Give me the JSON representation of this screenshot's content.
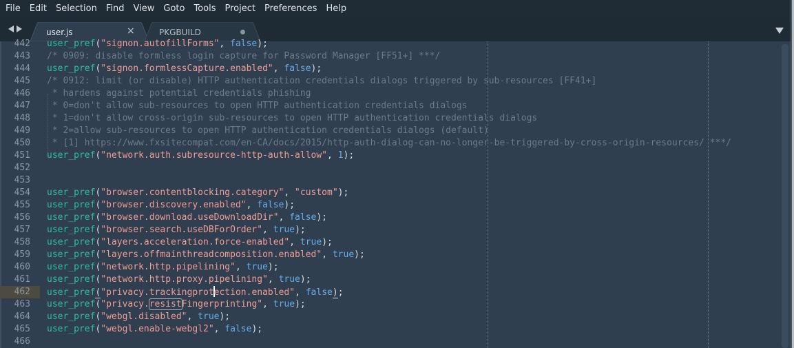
{
  "menubar": {
    "items": [
      "File",
      "Edit",
      "Selection",
      "Find",
      "View",
      "Goto",
      "Tools",
      "Project",
      "Preferences",
      "Help"
    ]
  },
  "tabs": [
    {
      "label": "user.js",
      "active": true,
      "state_icon": "close-icon",
      "close_glyph": "×"
    },
    {
      "label": "PKGBUILD",
      "active": false,
      "state_icon": "unsaved-dot-icon"
    }
  ],
  "navigation": {
    "back_icon": "arrow-left-icon",
    "forward_icon": "arrow-right-icon",
    "tab_menu_icon": "triangle-down-icon"
  },
  "editor": {
    "active_line": 462,
    "find_match": {
      "line": 463,
      "text": "resist"
    },
    "colors": {
      "background": "#2f3f50",
      "function": "#2ebf9f",
      "string": "#f09c94",
      "boolean": "#66aee8",
      "comment": "#6a7b8a",
      "line_number": "#8b97a2",
      "active_gutter": "#4d4a3f"
    },
    "lines": [
      {
        "n": "442",
        "tokens": [
          [
            "fn",
            "user_pref"
          ],
          [
            "p",
            "("
          ],
          [
            "s",
            "\"signon.autofillForms\""
          ],
          [
            "p",
            ", "
          ],
          [
            "b",
            "false"
          ],
          [
            "p",
            ");"
          ]
        ]
      },
      {
        "n": "443",
        "tokens": [
          [
            "c",
            "/* 0909: disable formless login capture for Password Manager [FF51+] ***/"
          ]
        ]
      },
      {
        "n": "444",
        "tokens": [
          [
            "fn",
            "user_pref"
          ],
          [
            "p",
            "("
          ],
          [
            "s",
            "\"signon.formlessCapture.enabled\""
          ],
          [
            "p",
            ", "
          ],
          [
            "b",
            "false"
          ],
          [
            "p",
            ");"
          ]
        ]
      },
      {
        "n": "445",
        "tokens": [
          [
            "c",
            "/* 0912: limit (or disable) HTTP authentication credentials dialogs triggered by sub-resources [FF41+]"
          ]
        ]
      },
      {
        "n": "446",
        "tokens": [
          [
            "c",
            " * hardens against potential credentials phishing"
          ]
        ]
      },
      {
        "n": "447",
        "tokens": [
          [
            "c",
            " * 0=don't allow sub-resources to open HTTP authentication credentials dialogs"
          ]
        ]
      },
      {
        "n": "448",
        "tokens": [
          [
            "c",
            " * 1=don't allow cross-origin sub-resources to open HTTP authentication credentials dialogs"
          ]
        ]
      },
      {
        "n": "449",
        "tokens": [
          [
            "c",
            " * 2=allow sub-resources to open HTTP authentication credentials dialogs (default)"
          ]
        ]
      },
      {
        "n": "450",
        "tokens": [
          [
            "c",
            " * [1] https://www.fxsitecompat.com/en-CA/docs/2015/http-auth-dialog-can-no-longer-be-triggered-by-cross-origin-resources/ ***/"
          ]
        ]
      },
      {
        "n": "451",
        "tokens": [
          [
            "fn",
            "user_pref"
          ],
          [
            "p",
            "("
          ],
          [
            "s",
            "\"network.auth.subresource-http-auth-allow\""
          ],
          [
            "p",
            ", "
          ],
          [
            "n",
            "1"
          ],
          [
            "p",
            ");"
          ]
        ]
      },
      {
        "n": "452",
        "tokens": []
      },
      {
        "n": "453",
        "tokens": []
      },
      {
        "n": "454",
        "tokens": [
          [
            "fn",
            "user_pref"
          ],
          [
            "p",
            "("
          ],
          [
            "s",
            "\"browser.contentblocking.category\""
          ],
          [
            "p",
            ", "
          ],
          [
            "s",
            "\"custom\""
          ],
          [
            "p",
            ");"
          ]
        ]
      },
      {
        "n": "455",
        "tokens": [
          [
            "fn",
            "user_pref"
          ],
          [
            "p",
            "("
          ],
          [
            "s",
            "\"browser.discovery.enabled\""
          ],
          [
            "p",
            ", "
          ],
          [
            "b",
            "false"
          ],
          [
            "p",
            ");"
          ]
        ]
      },
      {
        "n": "456",
        "tokens": [
          [
            "fn",
            "user_pref"
          ],
          [
            "p",
            "("
          ],
          [
            "s",
            "\"browser.download.useDownloadDir\""
          ],
          [
            "p",
            ", "
          ],
          [
            "b",
            "false"
          ],
          [
            "p",
            ");"
          ]
        ]
      },
      {
        "n": "457",
        "tokens": [
          [
            "fn",
            "user_pref"
          ],
          [
            "p",
            "("
          ],
          [
            "s",
            "\"browser.search.useDBForOrder\""
          ],
          [
            "p",
            ", "
          ],
          [
            "b",
            "true"
          ],
          [
            "p",
            ");"
          ]
        ]
      },
      {
        "n": "458",
        "tokens": [
          [
            "fn",
            "user_pref"
          ],
          [
            "p",
            "("
          ],
          [
            "s",
            "\"layers.acceleration.force-enabled\""
          ],
          [
            "p",
            ", "
          ],
          [
            "b",
            "true"
          ],
          [
            "p",
            ");"
          ]
        ]
      },
      {
        "n": "459",
        "tokens": [
          [
            "fn",
            "user_pref"
          ],
          [
            "p",
            "("
          ],
          [
            "s",
            "\"layers.offmainthreadcomposition.enabled\""
          ],
          [
            "p",
            ", "
          ],
          [
            "b",
            "true"
          ],
          [
            "p",
            ");"
          ]
        ]
      },
      {
        "n": "460",
        "tokens": [
          [
            "fn",
            "user_pref"
          ],
          [
            "p",
            "("
          ],
          [
            "s",
            "\"network.http.pipelining\""
          ],
          [
            "p",
            ", "
          ],
          [
            "b",
            "true"
          ],
          [
            "p",
            ");"
          ]
        ]
      },
      {
        "n": "461",
        "tokens": [
          [
            "fn",
            "user_pref"
          ],
          [
            "p",
            "("
          ],
          [
            "s",
            "\"network.http.proxy.pipelining\""
          ],
          [
            "p",
            ", "
          ],
          [
            "b",
            "true"
          ],
          [
            "p",
            ");"
          ]
        ]
      },
      {
        "n": "462",
        "tokens": [
          [
            "fn",
            "user_pref"
          ],
          [
            "bm",
            "("
          ],
          [
            "s",
            "\"privacy.trackingprot"
          ],
          [
            "cursor",
            ""
          ],
          [
            "s",
            "ection.enabled\""
          ],
          [
            "p",
            ", "
          ],
          [
            "b",
            "false"
          ],
          [
            "bm",
            ")"
          ],
          [
            "p",
            ";"
          ]
        ]
      },
      {
        "n": "463",
        "tokens": [
          [
            "fn",
            "user_pref"
          ],
          [
            "p",
            "("
          ],
          [
            "s",
            "\"privacy."
          ],
          [
            "sfind",
            "resist"
          ],
          [
            "s",
            "Fingerprinting\""
          ],
          [
            "p",
            ", "
          ],
          [
            "b",
            "true"
          ],
          [
            "p",
            ");"
          ]
        ]
      },
      {
        "n": "464",
        "tokens": [
          [
            "fn",
            "user_pref"
          ],
          [
            "p",
            "("
          ],
          [
            "s",
            "\"webgl.disabled\""
          ],
          [
            "p",
            ", "
          ],
          [
            "b",
            "true"
          ],
          [
            "p",
            ");"
          ]
        ]
      },
      {
        "n": "465",
        "tokens": [
          [
            "fn",
            "user_pref"
          ],
          [
            "p",
            "("
          ],
          [
            "s",
            "\"webgl.enable-webgl2\""
          ],
          [
            "p",
            ", "
          ],
          [
            "b",
            "false"
          ],
          [
            "p",
            ");"
          ]
        ]
      },
      {
        "n": "466",
        "tokens": []
      }
    ]
  }
}
